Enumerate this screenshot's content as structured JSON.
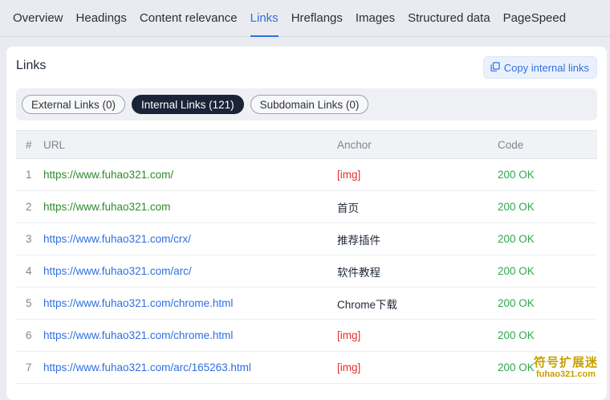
{
  "tabs": [
    {
      "label": "Overview",
      "active": false
    },
    {
      "label": "Headings",
      "active": false
    },
    {
      "label": "Content relevance",
      "active": false
    },
    {
      "label": "Links",
      "active": true
    },
    {
      "label": "Hreflangs",
      "active": false
    },
    {
      "label": "Images",
      "active": false
    },
    {
      "label": "Structured data",
      "active": false
    },
    {
      "label": "PageSpeed",
      "active": false
    }
  ],
  "panel": {
    "title": "Links",
    "copy_button": "Copy internal links",
    "copy_icon": "copy-icon"
  },
  "filters": [
    {
      "label": "External Links (0)",
      "active": false
    },
    {
      "label": "Internal Links (121)",
      "active": true
    },
    {
      "label": "Subdomain Links (0)",
      "active": false
    }
  ],
  "table": {
    "headers": {
      "num": "#",
      "url": "URL",
      "anchor": "Anchor",
      "code": "Code"
    },
    "rows": [
      {
        "num": "1",
        "url": "https://www.fuhao321.com/",
        "url_color": "green",
        "anchor": "[img]",
        "anchor_is_img": true,
        "code": "200 OK"
      },
      {
        "num": "2",
        "url": "https://www.fuhao321.com",
        "url_color": "green",
        "anchor": "首页",
        "anchor_is_img": false,
        "code": "200 OK"
      },
      {
        "num": "3",
        "url": "https://www.fuhao321.com/crx/",
        "url_color": "blue",
        "anchor": "推荐插件",
        "anchor_is_img": false,
        "code": "200 OK"
      },
      {
        "num": "4",
        "url": "https://www.fuhao321.com/arc/",
        "url_color": "blue",
        "anchor": "软件教程",
        "anchor_is_img": false,
        "code": "200 OK"
      },
      {
        "num": "5",
        "url": "https://www.fuhao321.com/chrome.html",
        "url_color": "blue",
        "anchor": "Chrome下载",
        "anchor_is_img": false,
        "code": "200 OK"
      },
      {
        "num": "6",
        "url": "https://www.fuhao321.com/chrome.html",
        "url_color": "blue",
        "anchor": "[img]",
        "anchor_is_img": true,
        "code": "200 OK"
      },
      {
        "num": "7",
        "url": "https://www.fuhao321.com/arc/165263.html",
        "url_color": "blue",
        "anchor": "[img]",
        "anchor_is_img": true,
        "code": "200 OK"
      }
    ]
  },
  "watermark": {
    "line1": "符号扩展迷",
    "line2": "fuhao321.com"
  },
  "colors": {
    "accent": "#2f6fe0",
    "status_ok": "#2ea84f",
    "img_anchor": "#e03131",
    "visited_url": "#2f8a2f",
    "active_pill": "#1b2436"
  }
}
